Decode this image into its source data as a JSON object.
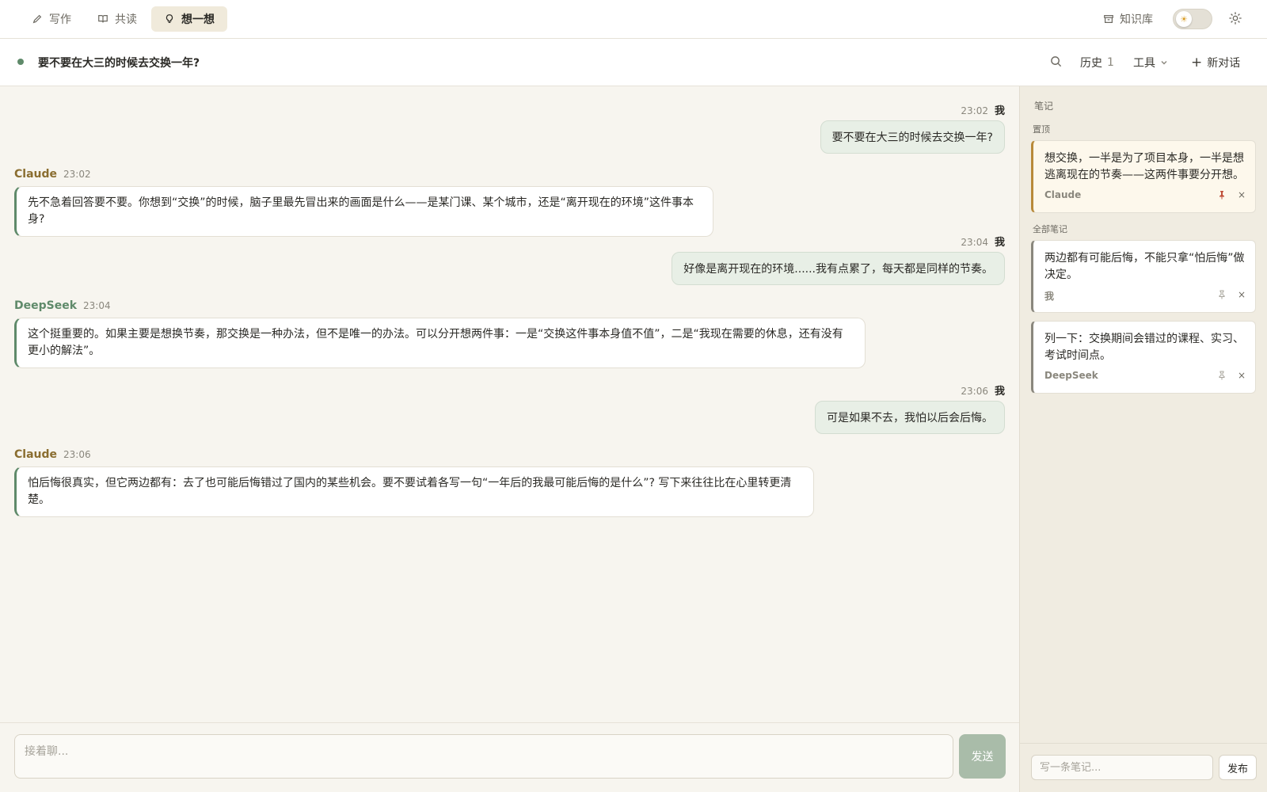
{
  "colors": {
    "accent_green": "#5f8a6a",
    "claude_name": "#8a6d2f",
    "deepseek_name": "#5f8a6a",
    "user_bubble": "#e8efe6",
    "pinned_bar": "#b88a3a",
    "pin_active": "#c0503a"
  },
  "nav": {
    "tabs": [
      {
        "label": "写作",
        "icon": "pencil-icon"
      },
      {
        "label": "共读",
        "icon": "book-icon"
      },
      {
        "label": "想一想",
        "icon": "lightbulb-icon",
        "active": true
      }
    ],
    "knowledge_base": "知识库",
    "theme_toggle_icon": "sun-icon",
    "settings_icon": "gear-icon"
  },
  "conversation": {
    "title": "要不要在大三的时候去交换一年?",
    "history_label": "历史",
    "history_count": "1",
    "tools_label": "工具",
    "new_chat_label": "新对话"
  },
  "messages": [
    {
      "role": "user",
      "author": "我",
      "time": "23:02",
      "text": "要不要在大三的时候去交换一年?"
    },
    {
      "role": "ai",
      "author": "Claude",
      "time": "23:02",
      "text": "先不急着回答要不要。你想到“交换”的时候，脑子里最先冒出来的画面是什么——是某门课、某个城市，还是“离开现在的环境”这件事本身?"
    },
    {
      "role": "user",
      "author": "我",
      "time": "23:04",
      "text": "好像是离开现在的环境......我有点累了，每天都是同样的节奏。"
    },
    {
      "role": "ai",
      "author": "DeepSeek",
      "time": "23:04",
      "text": "这个挺重要的。如果主要是想换节奏，那交换是一种办法，但不是唯一的办法。可以分开想两件事：一是“交换这件事本身值不值”，二是“我现在需要的休息，还有没有更小的解法”。"
    },
    {
      "role": "user",
      "author": "我",
      "time": "23:06",
      "text": "可是如果不去，我怕以后会后悔。"
    },
    {
      "role": "ai",
      "author": "Claude",
      "time": "23:06",
      "text": "怕后悔很真实，但它两边都有：去了也可能后悔错过了国内的某些机会。要不要试着各写一句“一年后的我最可能后悔的是什么”? 写下来往往比在心里转更清楚。"
    }
  ],
  "composer": {
    "placeholder": "接着聊...",
    "send_label": "发送"
  },
  "notes": {
    "title": "笔记",
    "pinned_label": "置顶",
    "all_label": "全部笔记",
    "pinned": [
      {
        "text": "想交换，一半是为了项目本身，一半是想逃离现在的节奏——这两件事要分开想。",
        "author": "Claude"
      }
    ],
    "all": [
      {
        "text": "两边都有可能后悔，不能只拿“怕后悔”做决定。",
        "author": "我"
      },
      {
        "text": "列一下：交换期间会错过的课程、实习、考试时间点。",
        "author": "DeepSeek"
      }
    ],
    "input_placeholder": "写一条笔记...",
    "publish_label": "发布"
  }
}
